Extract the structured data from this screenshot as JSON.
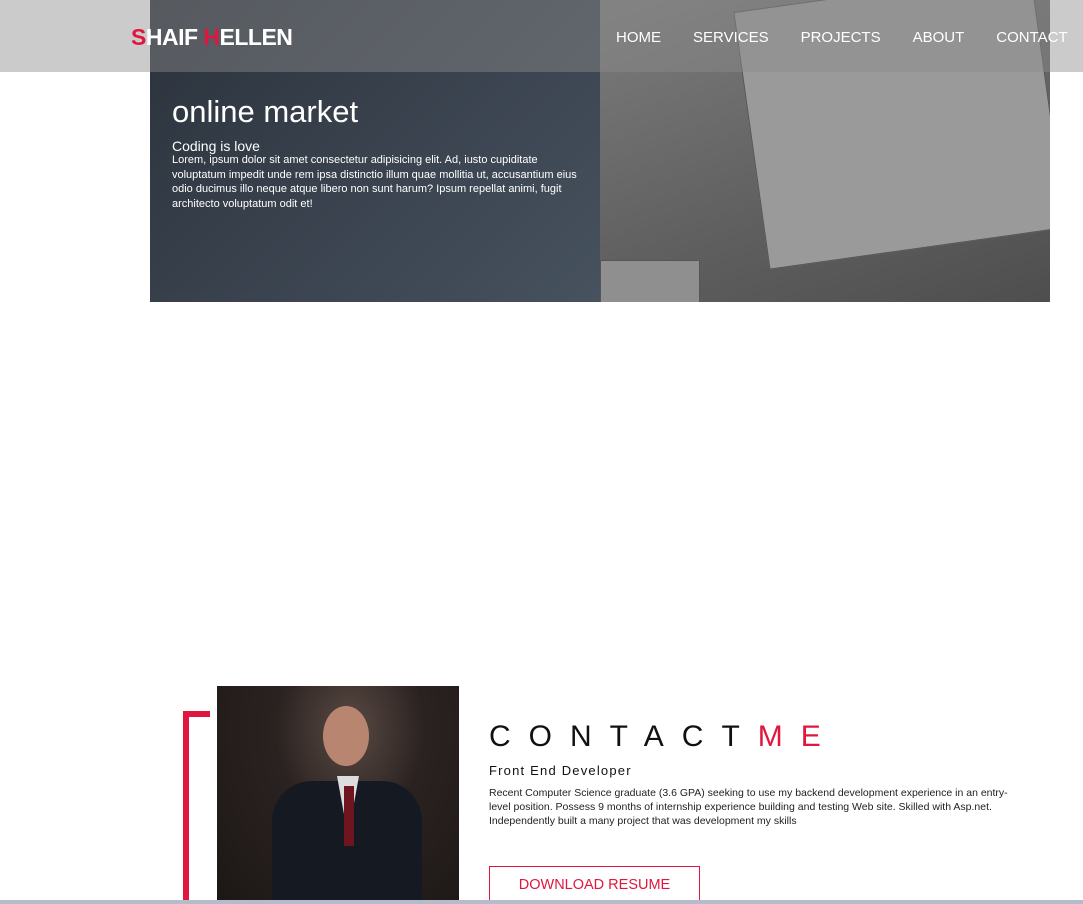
{
  "header": {
    "logo_first_initial": "S",
    "logo_first_rest": "HAIF ",
    "logo_last_initial": "H",
    "logo_last_rest": "ELLEN",
    "nav": [
      "HOME",
      "SERVICES",
      "PROJECTS",
      "ABOUT",
      "CONTACT"
    ]
  },
  "hero": {
    "title": "online market",
    "subtitle": "Coding is love",
    "body": "Lorem, ipsum dolor sit amet consectetur adipisicing elit. Ad, iusto cupiditate voluptatum impedit unde rem ipsa distinctio illum quae mollitia ut, accusantium eius odio ducimus illo neque atque libero non sunt harum? Ipsum repellat animi, fugit architecto voluptatum odit et!"
  },
  "contact": {
    "title_main": "CONTACT",
    "title_accent": "ME",
    "role": "Front End Developer",
    "description": "Recent Computer Science graduate (3.6 GPA) seeking to use my backend development experience in an entry-level position. Possess 9 months of internship experience building and testing Web site. Skilled with Asp.net. Independently built a many project that was development my skills",
    "button": "DOWNLOAD RESUME"
  },
  "colors": {
    "accent": "#e0163f"
  }
}
